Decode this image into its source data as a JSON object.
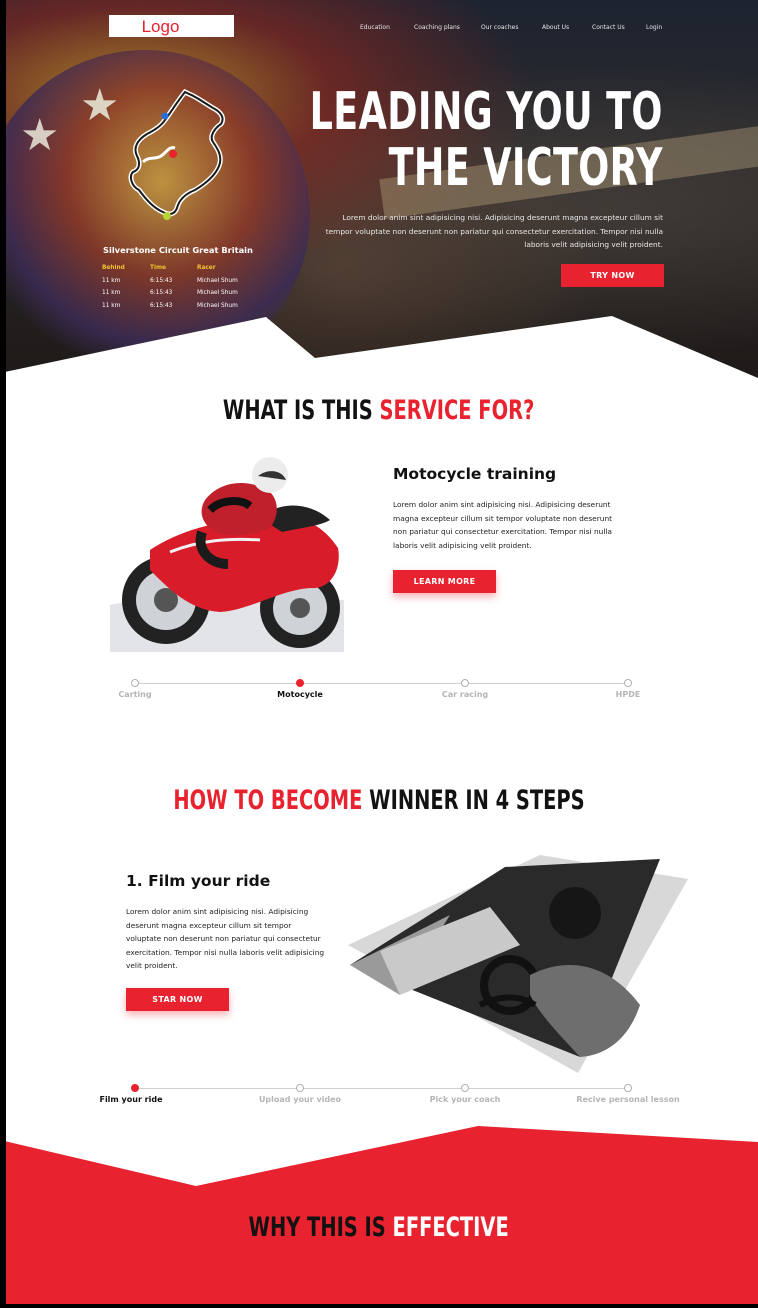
{
  "logo": {
    "text": "Logo"
  },
  "nav": {
    "items": [
      "Education",
      "Coaching plans",
      "Our coaches",
      "About Us",
      "Contact Us",
      "Login"
    ]
  },
  "hero": {
    "title_line1": "LEADING YOU TO",
    "title_line2": "THE VICTORY",
    "description": "Lorem dolor anim sint adipisicing nisi. Adipisicing deserunt magna excepteur cillum sit tempor voluptate non deserunt non pariatur qui consectetur exercitation. Tempor nisi nulla laboris velit adipisicing velit proident.",
    "cta": "TRY NOW",
    "circuit_name": "Silverstone Circuit Great Britain",
    "table": {
      "headers": [
        "Behind",
        "Time",
        "Racer"
      ],
      "rows": [
        [
          "11 km",
          "6:15:43",
          "Michael Shum"
        ],
        [
          "11 km",
          "6:15:43",
          "Michael Shum"
        ],
        [
          "11 km",
          "6:15:43",
          "Michael Shum"
        ]
      ]
    }
  },
  "service": {
    "heading_dark": "WHAT IS THIS ",
    "heading_red": "SERVICE FOR?",
    "card_title": "Motocycle training",
    "card_text": "Lorem dolor anim sint adipisicing nisi. Adipisicing deserunt magna excepteur cillum sit tempor voluptate non deserunt non pariatur qui consectetur exercitation. Tempor nisi nulla laboris velit adipisicing velit proident.",
    "cta": "LEARN MORE",
    "timeline": [
      "Carting",
      "Motocycle",
      "Car racing",
      "HPDE"
    ],
    "active_index": 1
  },
  "steps": {
    "heading_red": "HOW TO BECOME ",
    "heading_dark": "WINNER IN 4 STEPS",
    "step_title": "1. Film your ride",
    "step_text": "Lorem dolor anim sint adipisicing nisi. Adipisicing deserunt magna excepteur cillum sit tempor voluptate non deserunt non pariatur qui consectetur exercitation. Tempor nisi nulla laboris velit adipisicing velit proident.",
    "cta": "STAR NOW",
    "timeline": [
      "Film your ride",
      "Upload your video",
      "Pick your coach",
      "Recive personal lesson"
    ],
    "active_index": 0
  },
  "effective": {
    "heading_dark": "WHY THIS IS ",
    "heading_white": "EFFECTIVE"
  },
  "colors": {
    "accent": "#e8222e",
    "text": "#111111",
    "muted": "#b5b5b5"
  }
}
